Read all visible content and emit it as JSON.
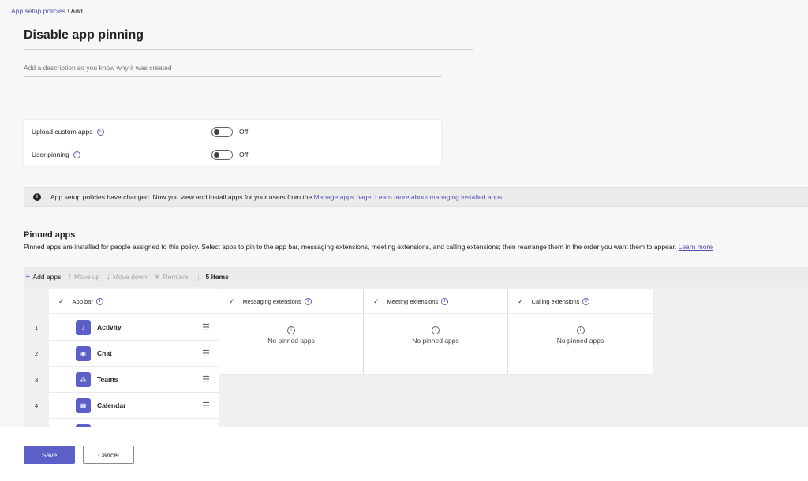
{
  "breadcrumb": {
    "parent": "App setup policies",
    "separator": " \\ ",
    "current": "Add"
  },
  "title": "Disable app pinning",
  "description": {
    "placeholder": "Add a description so you know why it was created",
    "value": ""
  },
  "settings": [
    {
      "label": "Upload custom apps",
      "state": "Off"
    },
    {
      "label": "User pinning",
      "state": "Off"
    }
  ],
  "banner": {
    "text_before": "App setup policies have changed. Now you view and install apps for your users from the ",
    "link1": "Manage apps page",
    "text_mid": ". ",
    "link2": "Learn more about managing installed apps",
    "text_after": "."
  },
  "pinned": {
    "title": "Pinned apps",
    "description": "Pinned apps are installed for people assigned to this policy. Select apps to pin to the app bar, messaging extensions, meeting extensions, and calling extensions; then rearrange them in the order you want them to appear. ",
    "learn_more": "Learn more"
  },
  "toolbar": {
    "add": "Add apps",
    "move_up": "Move up",
    "move_down": "Move down",
    "remove": "Remove",
    "count": "5 items"
  },
  "columns": {
    "app_bar": "App bar",
    "messaging": "Messaging extensions",
    "meeting": "Meeting extensions",
    "calling": "Calling extensions",
    "empty": "No pinned apps"
  },
  "apps": [
    {
      "num": "1",
      "name": "Activity",
      "icon": "bell-icon"
    },
    {
      "num": "2",
      "name": "Chat",
      "icon": "chat-icon"
    },
    {
      "num": "3",
      "name": "Teams",
      "icon": "teams-icon"
    },
    {
      "num": "4",
      "name": "Calendar",
      "icon": "calendar-icon"
    }
  ],
  "footer": {
    "save": "Save",
    "cancel": "Cancel"
  },
  "colors": {
    "accent": "#5b5fc7",
    "link": "#4f52b2"
  }
}
